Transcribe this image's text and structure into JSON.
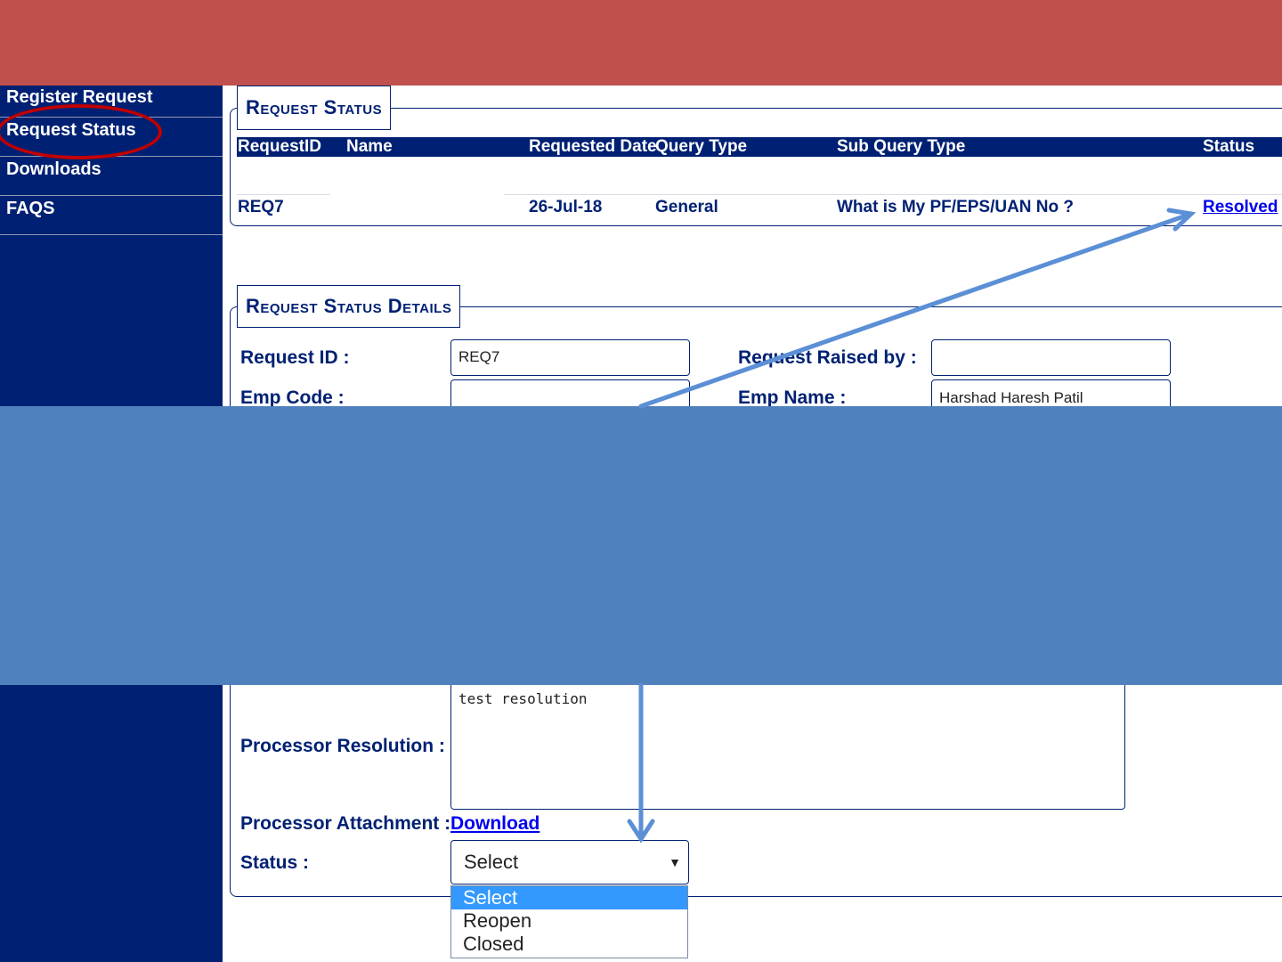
{
  "sidebar": {
    "items": [
      {
        "label": "Register Request"
      },
      {
        "label": "Request Status"
      },
      {
        "label": "Downloads"
      },
      {
        "label": "FAQS"
      }
    ]
  },
  "request_status": {
    "legend": "Request Status",
    "columns": [
      "RequestID",
      "Name",
      "Requested Date",
      "Query Type",
      "Sub Query Type",
      "Status"
    ],
    "row": {
      "request_id": "REQ7",
      "name": "",
      "requested_date": "26-Jul-18",
      "query_type": "General",
      "sub_query_type": "What is My PF/EPS/UAN No ?",
      "status": "Resolved"
    }
  },
  "details": {
    "legend": "Request Status Details",
    "request_id_label": "Request ID :",
    "request_id_value": "REQ7",
    "raised_by_label": "Request Raised by :",
    "raised_by_value": "",
    "emp_code_label": "Emp Code :",
    "emp_code_value": "",
    "emp_name_label": "Emp Name :",
    "emp_name_value": "Harshad Haresh Patil",
    "resolution_label": "Processor Resolution :",
    "resolution_value": "test resolution",
    "attachment_label": "Processor Attachment :",
    "attachment_link": "Download",
    "status_label": "Status :",
    "status_selected": "Select",
    "status_options": [
      "Select",
      "Reopen",
      "Closed"
    ]
  },
  "colors": {
    "header": "#c0504d",
    "sidebar": "#002173",
    "overlay": "#4f81bd",
    "arrow": "#5b8fd6",
    "highlight": "#c00000"
  }
}
